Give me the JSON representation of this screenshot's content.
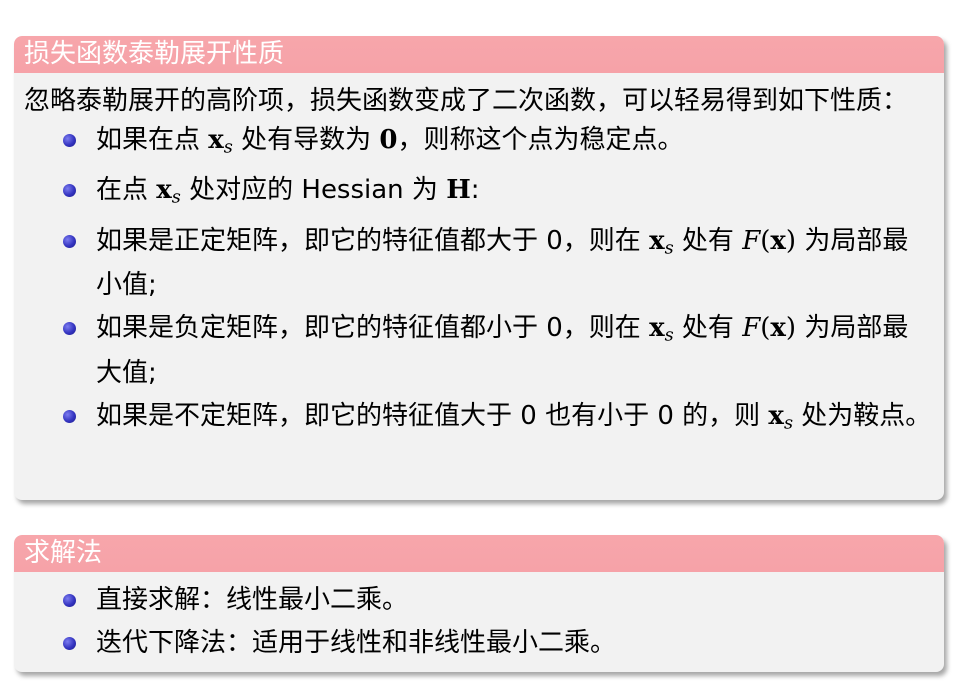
{
  "block1": {
    "title": "损失函数泰勒展开性质",
    "intro": "忽略泰勒展开的高阶项，损失函数变成了二次函数，可以轻易得到如下性质：",
    "items": [
      {
        "a": "如果在点 ",
        "m1": "x",
        "s1": "s",
        "b": " 处有导数为 ",
        "m2": "0",
        "c": "，则称这个点为稳定点。"
      },
      {
        "a": "在点 ",
        "m1": "x",
        "s1": "s",
        "b": " 处对应的 Hessian 为 ",
        "m2": "H",
        "c": ":"
      },
      {
        "a": "如果是正定矩阵，即它的特征值都大于 0，则在 ",
        "m1": "x",
        "s1": "s",
        "b": " 处有 ",
        "f": "F",
        "paren_open": "(",
        "m2": "x",
        "paren_close": ")",
        "c": " 为局部最小值;"
      },
      {
        "a": "如果是负定矩阵，即它的特征值都小于 0，则在 ",
        "m1": "x",
        "s1": "s",
        "b": " 处有 ",
        "f": "F",
        "paren_open": "(",
        "m2": "x",
        "paren_close": ")",
        "c": " 为局部最大值;"
      },
      {
        "a": "如果是不定矩阵，即它的特征值大于 0 也有小于 0 的，则 ",
        "m1": "x",
        "s1": "s",
        "b": " 处为鞍点。"
      }
    ]
  },
  "block2": {
    "title": "求解法",
    "items": [
      "直接求解：线性最小二乘。",
      "迭代下降法：适用于线性和非线性最小二乘。"
    ]
  },
  "colors": {
    "title_bg": "#f6a2a8",
    "body_bg": "#f2f2f2",
    "bullet": "#3434c0"
  }
}
